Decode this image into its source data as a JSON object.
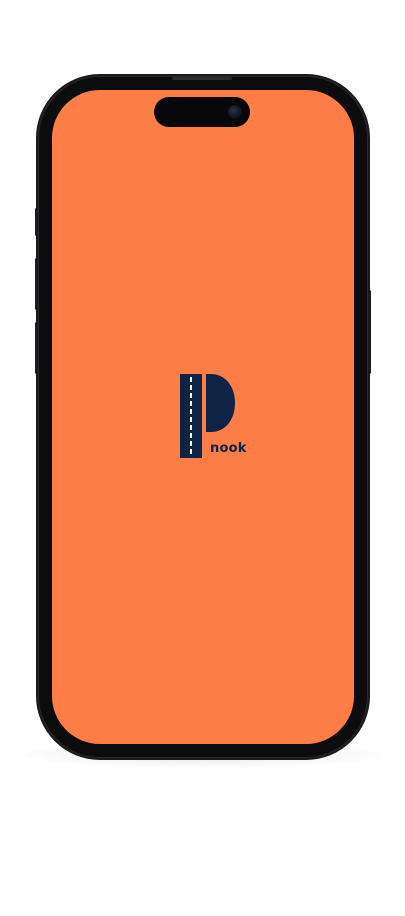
{
  "app": {
    "logo_text": "nook",
    "logo_icon": "parking-road-logo",
    "screen_color": "#ff7d47",
    "logo_color": "#0d2445",
    "road_dash_color": "#ffffff"
  }
}
